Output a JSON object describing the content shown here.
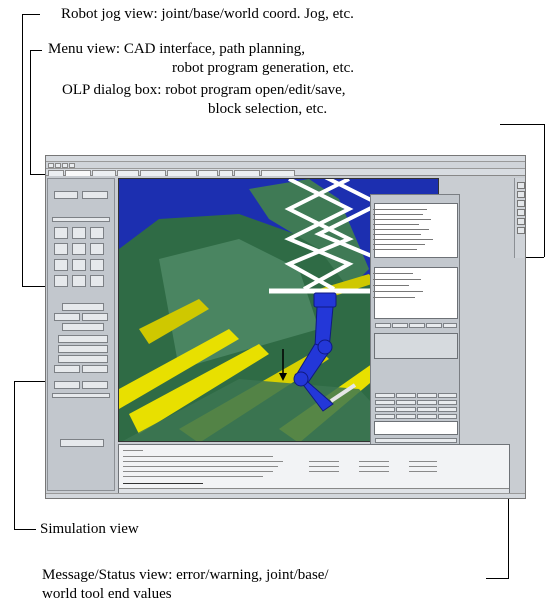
{
  "captions": {
    "robot_jog": "Robot jog view: joint/base/world coord. Jog, etc.",
    "menu_line1": "Menu view: CAD interface, path planning,",
    "menu_line2": "robot program generation, etc.",
    "olp_line1": "OLP dialog box: robot program open/edit/save,",
    "olp_line2": "block selection, etc.",
    "simulation": "Simulation view",
    "message_line1": "Message/Status view: error/warning, joint/base/",
    "message_line2": "world tool end values"
  },
  "colors": {
    "sim_background": "#1c2fb0",
    "steel_green": "#3f7a55",
    "steel_yellow": "#e8e000",
    "robot_blue": "#2337d8",
    "panel_gray": "#c3c8ce"
  },
  "icons": {
    "arrow": "arrow-icon"
  }
}
